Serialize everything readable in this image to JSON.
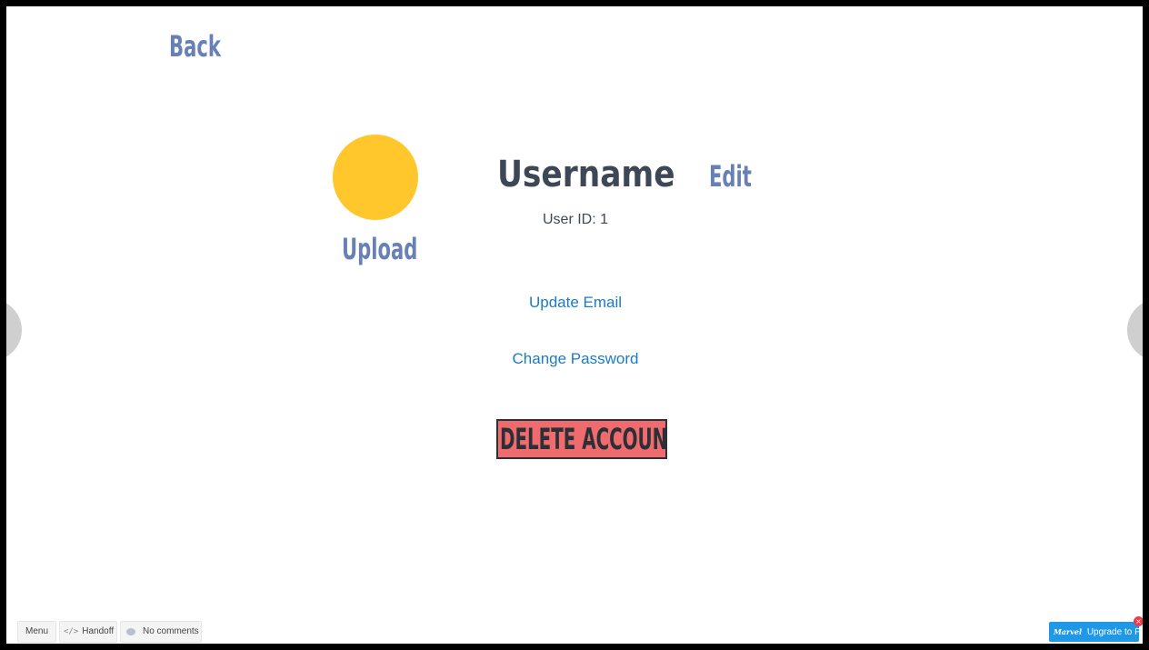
{
  "profile": {
    "back_label": "Back",
    "upload_label": "Upload",
    "username": "Username",
    "edit_label": "Edit",
    "user_id": "User ID: 1",
    "update_email_label": "Update Email",
    "change_password_label": "Change Password",
    "delete_account_label": "DELETE ACCOUNT"
  },
  "toolbar": {
    "menu_label": "Menu",
    "handoff_glyph": "</>",
    "handoff_label": "Handoff",
    "comments_label": "No comments",
    "upgrade_logo": "Marvel",
    "upgrade_label": "Upgrade to Pro",
    "close_glyph": "×"
  },
  "colors": {
    "accent_link": "#6781b6",
    "text_link": "#1b7bc4",
    "avatar": "#ffc72c",
    "danger": "#ef6b6e",
    "upgrade": "#1f98e6"
  }
}
